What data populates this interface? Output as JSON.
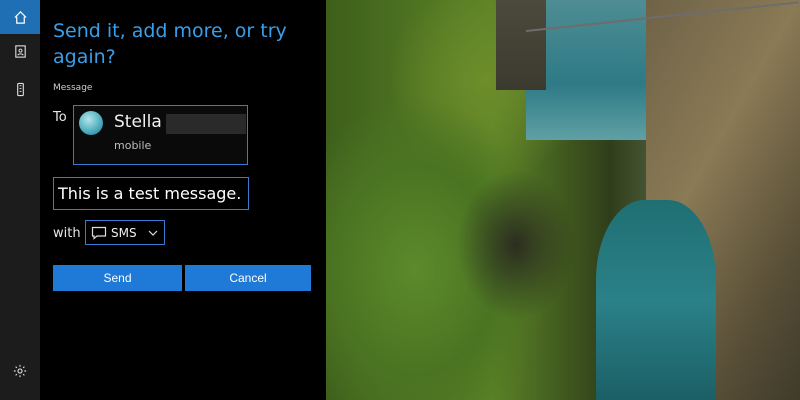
{
  "panel": {
    "title": "Send it, add more, or try again?",
    "section_label": "Message",
    "to_label": "To",
    "contact": {
      "name": "Stella",
      "sub": "mobile"
    },
    "message_text": "This is a test message.",
    "with_label": "with",
    "channel": {
      "value": "SMS"
    },
    "send_label": "Send",
    "cancel_label": "Cancel"
  },
  "rail": {
    "icons": [
      "home-icon",
      "notebook-icon",
      "phone-icon"
    ],
    "settings_icon": "gear-icon"
  },
  "colors": {
    "accent": "#1e7ad6",
    "title": "#3a9ee9",
    "rail_bg": "#1c1c1c"
  }
}
